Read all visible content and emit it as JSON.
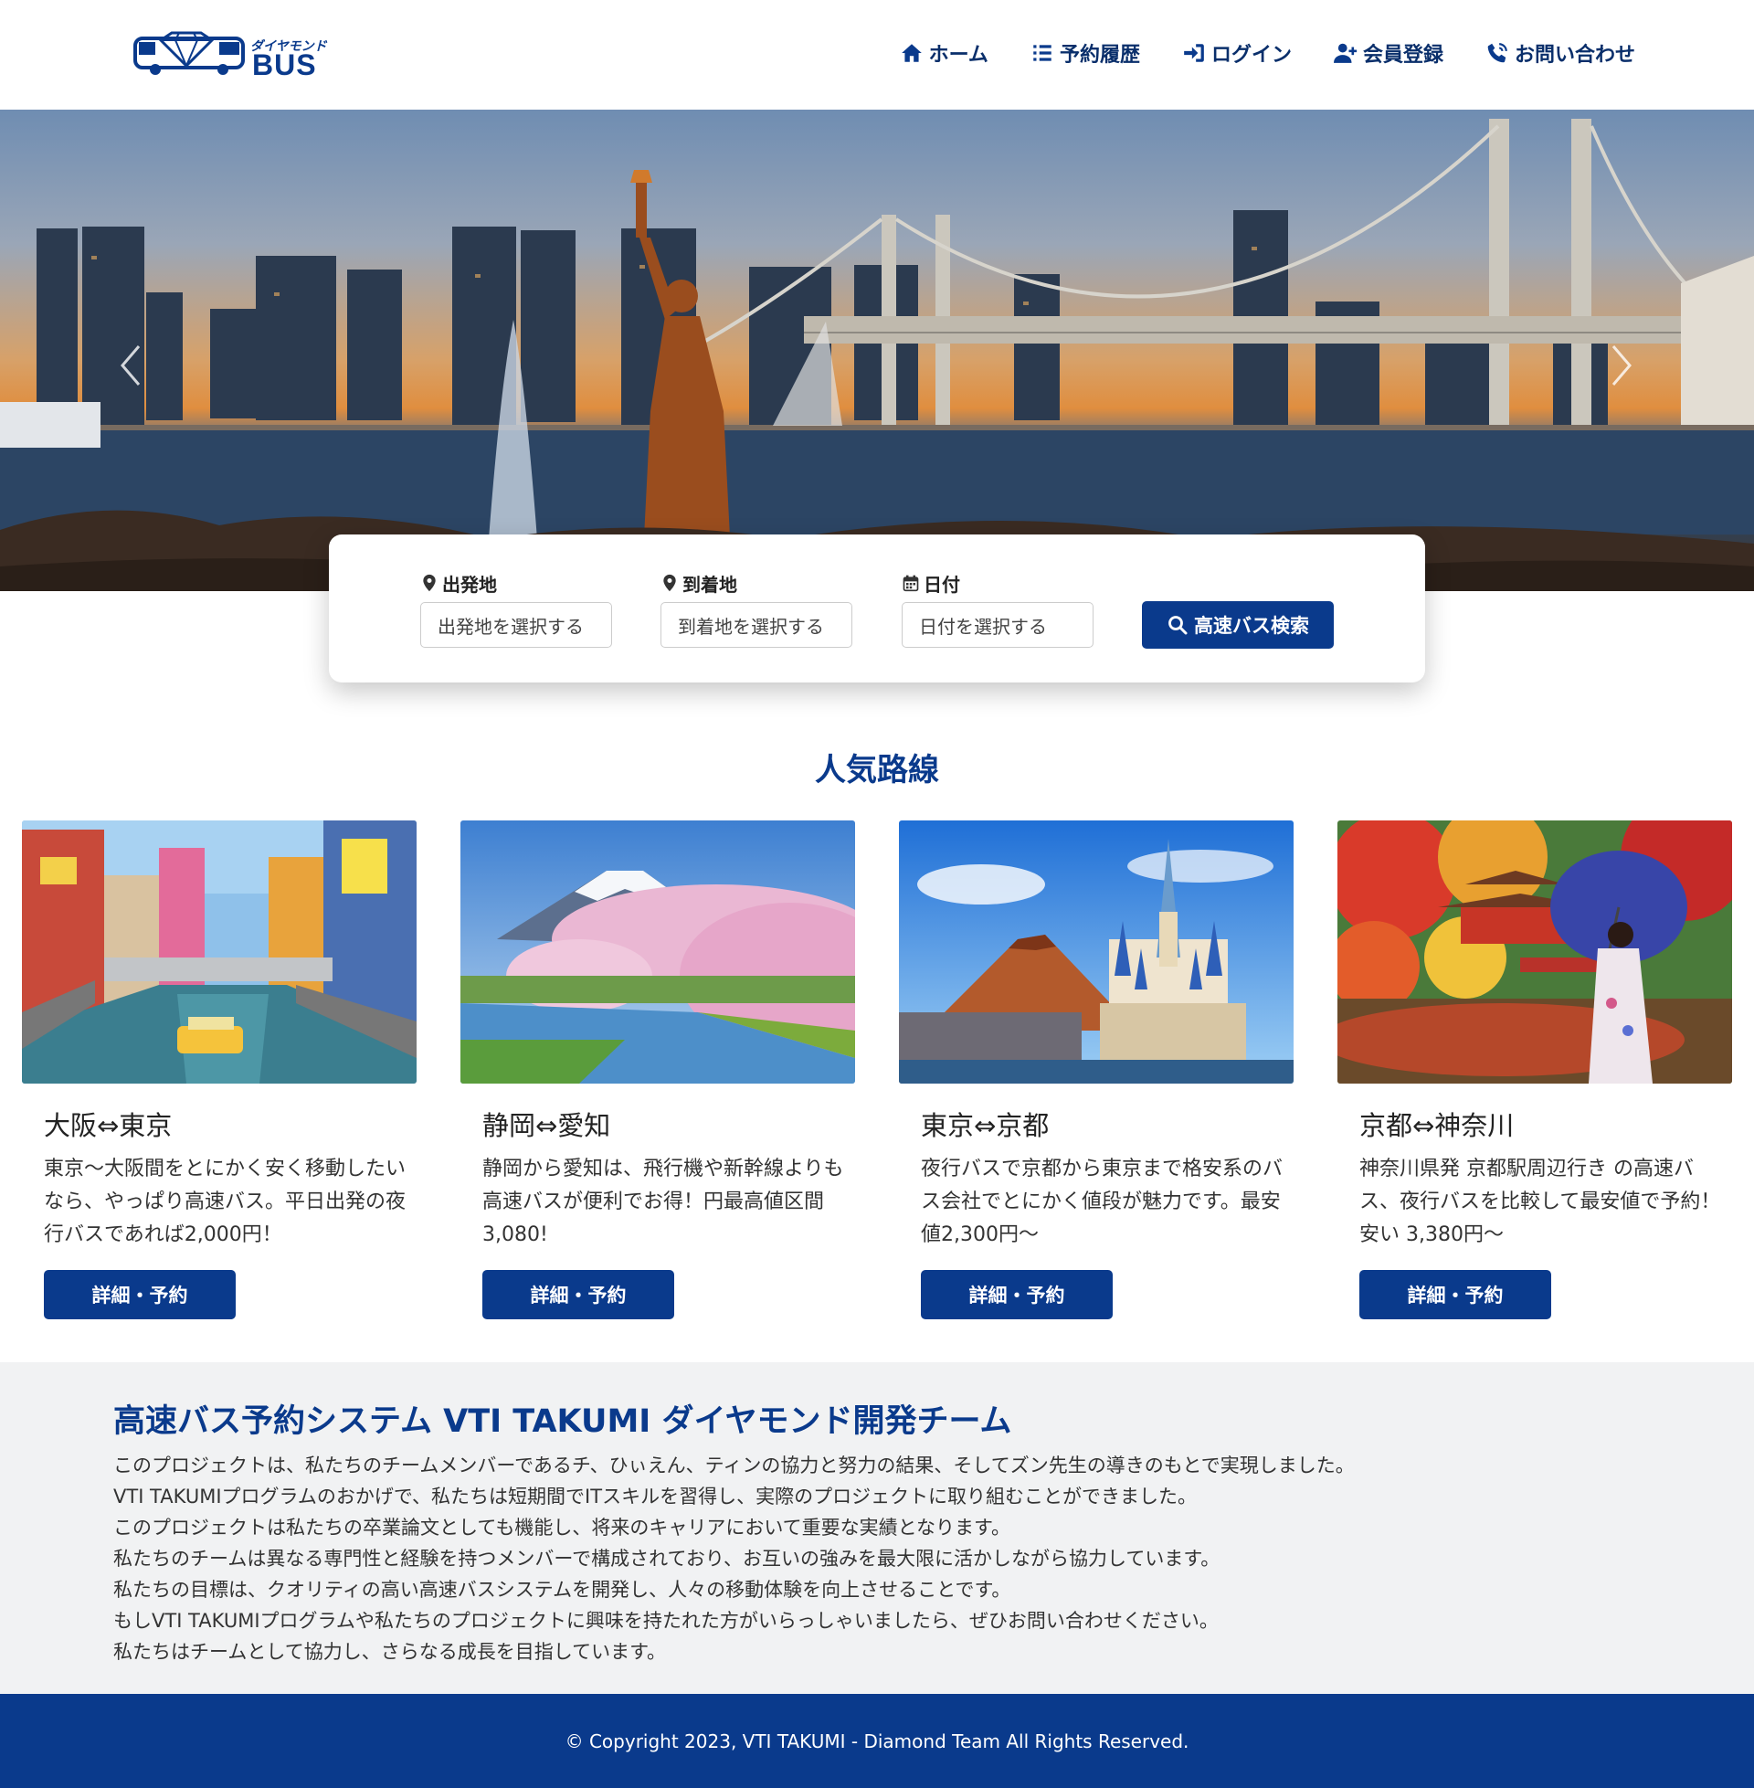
{
  "header": {
    "logo_kana": "ダイヤモンド",
    "logo_text": "BUS",
    "nav": [
      {
        "label": "ホーム",
        "icon": "home-icon"
      },
      {
        "label": "予約履歴",
        "icon": "list-icon"
      },
      {
        "label": "ログイン",
        "icon": "login-icon"
      },
      {
        "label": "会員登録",
        "icon": "user-plus-icon"
      },
      {
        "label": "お問い合わせ",
        "icon": "phone-icon"
      }
    ]
  },
  "hero": {
    "prev_icon": "chevron-left-icon",
    "next_icon": "chevron-right-icon"
  },
  "search": {
    "departure_label": "出発地",
    "departure_placeholder": "出発地を選択する",
    "arrival_label": "到着地",
    "arrival_placeholder": "到着地を選択する",
    "date_label": "日付",
    "date_placeholder": "日付を選択する",
    "button_label": "高速バス検索"
  },
  "routes": {
    "title": "人気路線",
    "cards": [
      {
        "title": "大阪⇔東京",
        "text": "東京～大阪間をとにかく安く移動したいなら、やっぱり高速バス。平日出発の夜行バスであれば2,000円！",
        "button": "詳細・予約"
      },
      {
        "title": "静岡⇔愛知",
        "text": "静岡から愛知は、飛行機や新幹線よりも高速バスが便利でお得！円最高値区間 3,080!",
        "button": "詳細・予約"
      },
      {
        "title": "東京⇔京都",
        "text": "夜行バスで京都から東京まで格安系のバス会社でとにかく値段が魅力です。最安値2,300円～",
        "button": "詳細・予約"
      },
      {
        "title": "京都⇔神奈川",
        "text": "神奈川県発 京都駅周辺行き の高速バス、夜行バスを比較して最安値で予約！安い 3,380円～",
        "button": "詳細・予約"
      }
    ]
  },
  "about": {
    "title": "高速バス予約システム VTI TAKUMI ダイヤモンド開発チーム",
    "lines": [
      "このプロジェクトは、私たちのチームメンバーであるチ、ひぃえん、ティンの協力と努力の結果、そしてズン先生の導きのもとで実現しました。",
      "VTI TAKUMIプログラムのおかげで、私たちは短期間でITスキルを習得し、実際のプロジェクトに取り組むことができました。",
      "このプロジェクトは私たちの卒業論文としても機能し、将来のキャリアにおいて重要な実績となります。",
      "私たちのチームは異なる専門性と経験を持つメンバーで構成されており、お互いの強みを最大限に活かしながら協力しています。",
      "私たちの目標は、クオリティの高い高速バスシステムを開発し、人々の移動体験を向上させることです。",
      "もしVTI TAKUMIプログラムや私たちのプロジェクトに興味を持たれた方がいらっしゃいましたら、ぜひお問い合わせください。",
      "私たちはチームとして協力し、さらなる成長を目指しています。"
    ]
  },
  "footer": {
    "copyright": "© Copyright 2023, VTI TAKUMI - Diamond Team All Rights Reserved."
  },
  "colors": {
    "brand": "#0a3a8c",
    "about_bg": "#f1f2f3"
  }
}
